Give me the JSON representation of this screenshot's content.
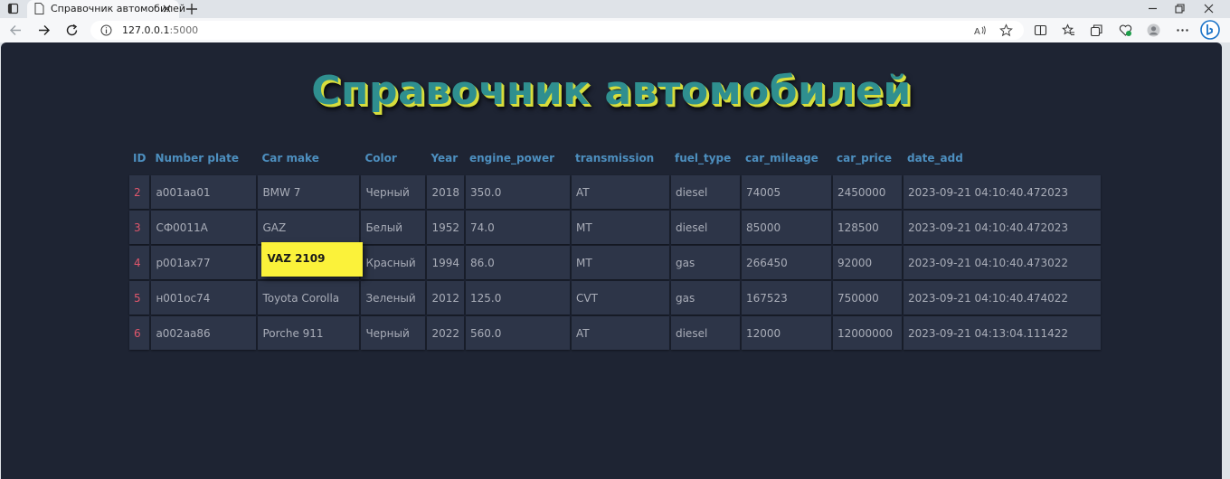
{
  "browser": {
    "tab_title": "Справочник автомобилей",
    "url_host": "127.0.0.1",
    "url_port": ":5000"
  },
  "page": {
    "title": "Справочник автомобилей"
  },
  "table": {
    "headers": [
      "ID",
      "Number plate",
      "Car make",
      "Color",
      "Year",
      "engine_power",
      "transmission",
      "fuel_type",
      "car_mileage",
      "car_price",
      "date_add"
    ],
    "rows": [
      [
        "2",
        "a001aa01",
        "BMW 7",
        "Черный",
        "2018",
        "350.0",
        "AT",
        "diesel",
        "74005",
        "2450000",
        "2023-09-21 04:10:40.472023"
      ],
      [
        "3",
        "СФ0011А",
        "GAZ",
        "Белый",
        "1952",
        "74.0",
        "MT",
        "diesel",
        "85000",
        "128500",
        "2023-09-21 04:10:40.472023"
      ],
      [
        "4",
        "p001ax77",
        "VAZ 2109",
        "Красный",
        "1994",
        "86.0",
        "MT",
        "gas",
        "266450",
        "92000",
        "2023-09-21 04:10:40.473022"
      ],
      [
        "5",
        "н001ос74",
        "Toyota Corolla",
        "Зеленый",
        "2012",
        "125.0",
        "CVT",
        "gas",
        "167523",
        "750000",
        "2023-09-21 04:10:40.474022"
      ],
      [
        "6",
        "a002aa86",
        "Porche 911",
        "Черный",
        "2022",
        "560.0",
        "AT",
        "diesel",
        "12000",
        "12000000",
        "2023-09-21 04:13:04.111422"
      ]
    ]
  },
  "colors": {
    "background": "#1e2433",
    "cell": "#2d3548",
    "header_text": "#4d8fbf",
    "id_text": "#e0576c",
    "highlight": "#fbf23a"
  }
}
